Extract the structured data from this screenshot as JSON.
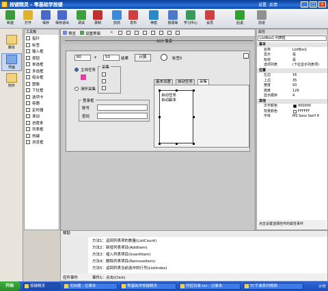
{
  "window": {
    "title": "按键精灵 - 零基础学按键",
    "menu_right": [
      "设置",
      "反馈"
    ]
  },
  "toolbar": [
    {
      "label": "新建",
      "icon": "new-icon",
      "color": "#3b9a3b"
    },
    {
      "label": "打开",
      "icon": "open-folder-icon",
      "color": "#e0b030"
    },
    {
      "label": "保存",
      "icon": "save-icon",
      "color": "#4a6ac8"
    },
    {
      "label": "保存退出",
      "icon": "save-exit-icon",
      "color": "#4a6ac8"
    },
    {
      "label": "调试",
      "icon": "debug-icon",
      "color": "#3aa03a"
    },
    {
      "label": "录制",
      "icon": "record-icon",
      "color": "#c03030"
    },
    {
      "label": "抓抓",
      "icon": "grab-icon",
      "color": "#3a8ad8"
    },
    {
      "label": "发布",
      "icon": "publish-icon",
      "color": "#d04040"
    },
    {
      "label": "神盾",
      "icon": "shield-icon",
      "color": "#2a8ac8"
    },
    {
      "label": "按源库",
      "icon": "library-icon",
      "color": "#4a7ac8"
    },
    {
      "label": "学习中心",
      "icon": "learning-icon",
      "color": "#3a9a5a"
    },
    {
      "label": "会员",
      "icon": "vip-icon",
      "color": "#d04040"
    },
    {
      "label": "后退",
      "icon": "back-arrow-icon",
      "color": "#30a030"
    },
    {
      "label": "前进",
      "icon": "forward-arrow-icon",
      "color": "#909090"
    }
  ],
  "leftnav": [
    {
      "label": "脚本",
      "icon": "script-icon"
    },
    {
      "label": "界面",
      "icon": "interface-icon"
    },
    {
      "label": "附件",
      "icon": "attachment-icon"
    }
  ],
  "toolbox": {
    "title": "工具箱",
    "items": [
      "指针",
      "标签",
      "输入框",
      "按钮",
      "单选框",
      "多选框",
      "组合框",
      "图像",
      "下拉框",
      "选项卡",
      "容器",
      "定时器",
      "滚动",
      "进度条",
      "列表框",
      "热键",
      "浏览框"
    ]
  },
  "designer": {
    "tools": [
      "预览",
      "设置界面"
    ],
    "width_label": "605 像素",
    "height_label": "像素",
    "num_a": "80",
    "num_b": "50",
    "result_label": "结果",
    "calc_button": "计算",
    "icon_label": "标签5",
    "radio1": "主线任务",
    "radio2": "清怀采集",
    "group_collect": "采集",
    "group_login": "登录框",
    "account_label": "账号",
    "password_label": "密码",
    "tabs": [
      "基本设置",
      "自动任务",
      "采集"
    ],
    "list_items": [
      "自动任务",
      "自动副本"
    ]
  },
  "properties": {
    "title": "属性",
    "dropdown": "ListBox1 列表框",
    "rows": [
      {
        "section": "基本"
      },
      {
        "k": "名称",
        "v": "ListBox1"
      },
      {
        "k": "显示",
        "v": "是"
      },
      {
        "k": "有效",
        "v": "是"
      },
      {
        "k": "选项列表",
        "v": "(下拉显示列表项)"
      },
      {
        "section": "位置"
      },
      {
        "k": "左边",
        "v": "16"
      },
      {
        "k": "上边",
        "v": "35"
      },
      {
        "k": "宽度",
        "v": "93"
      },
      {
        "k": "高度",
        "v": "129"
      },
      {
        "k": "显示顺序",
        "v": "4"
      },
      {
        "section": "其他"
      },
      {
        "k": "文字颜色",
        "v": "000000"
      },
      {
        "k": "背景颜色",
        "v": "FFFFFF"
      },
      {
        "k": "字体",
        "v": "MS Sans Serif 8"
      }
    ],
    "footer": "点击设置选择控件的属性事件"
  },
  "help": {
    "title": "帮助",
    "lines": [
      "方法1：返回列表项的数量(ListCount)",
      "方法2：新增列表项目(AddItem)",
      "方法3：插入列表项目(InsertItem)",
      "方法4：删除列表项目(RemoveItem)",
      "方法5：返回列表当前选中的行号(ListIndex)"
    ],
    "event_label": "控件事件",
    "event_value": "事件1：点击(Click)"
  },
  "taskbar": {
    "start": "开始",
    "tasks": [
      "按键精灵",
      "无标题 - 记事本",
      "零基础学按键精灵",
      "列控目录.txt - 记事本",
      "TC千录系列视频"
    ],
    "clock": "计时"
  }
}
